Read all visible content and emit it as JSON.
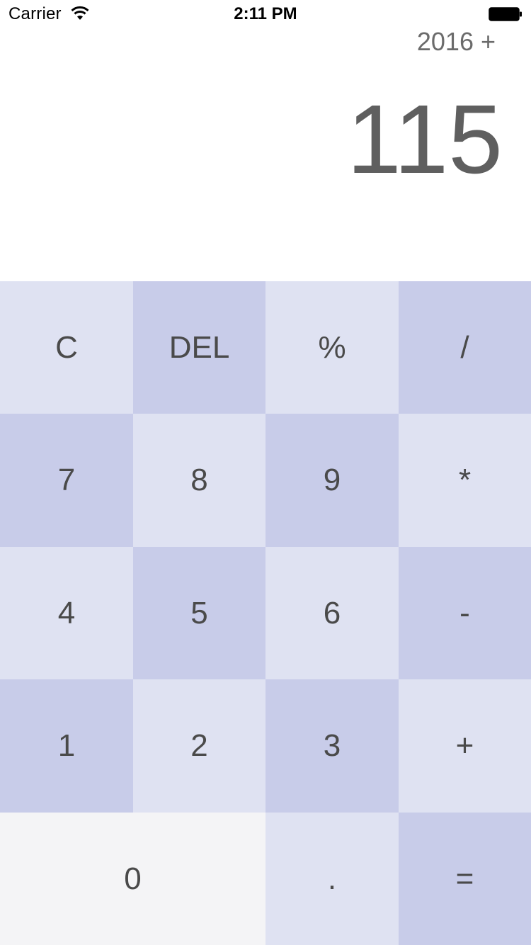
{
  "status_bar": {
    "carrier": "Carrier",
    "time": "2:11 PM",
    "icons": [
      "wifi-icon",
      "battery-icon"
    ]
  },
  "display": {
    "expression": "2016 +",
    "result": "115"
  },
  "keypad": {
    "row1": [
      "C",
      "DEL",
      "%",
      "/"
    ],
    "row2": [
      "7",
      "8",
      "9",
      "*"
    ],
    "row3": [
      "4",
      "5",
      "6",
      "-"
    ],
    "row4": [
      "1",
      "2",
      "3",
      "+"
    ],
    "row5": [
      "0",
      ".",
      "="
    ]
  },
  "colors": {
    "key_light": "#dfe2f2",
    "key_dark": "#c8cce9",
    "key_zero": "#f4f4f6",
    "key_text": "#4a4a4a",
    "display_text": "#5f5f5f"
  }
}
